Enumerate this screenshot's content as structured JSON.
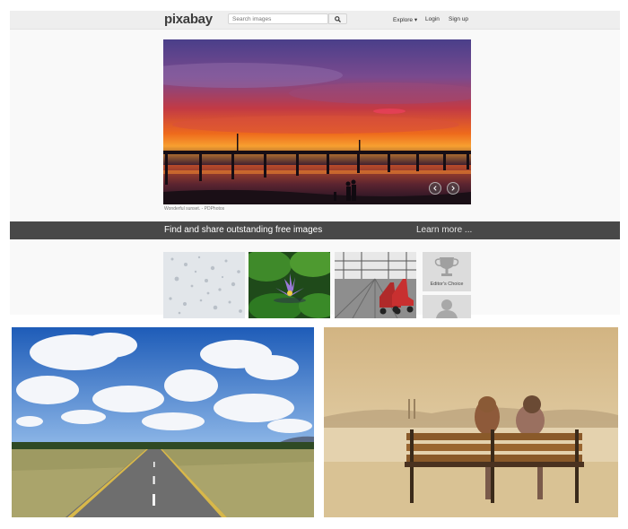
{
  "header": {
    "logo": "pixabay",
    "search_placeholder": "Search images",
    "nav": {
      "explore": "Explore ▾",
      "login": "Login",
      "signup": "Sign up"
    }
  },
  "hero": {
    "caption": "Wonderful sunset. - PDPhotos"
  },
  "banner": {
    "text": "Find and share outstanding free images",
    "learn_more": "Learn more ..."
  },
  "sidebar": {
    "editors_choice": "Editor's Choice"
  },
  "icons": [
    "search-icon",
    "chevron-left-icon",
    "chevron-right-icon",
    "trophy-icon",
    "avatar-icon"
  ]
}
